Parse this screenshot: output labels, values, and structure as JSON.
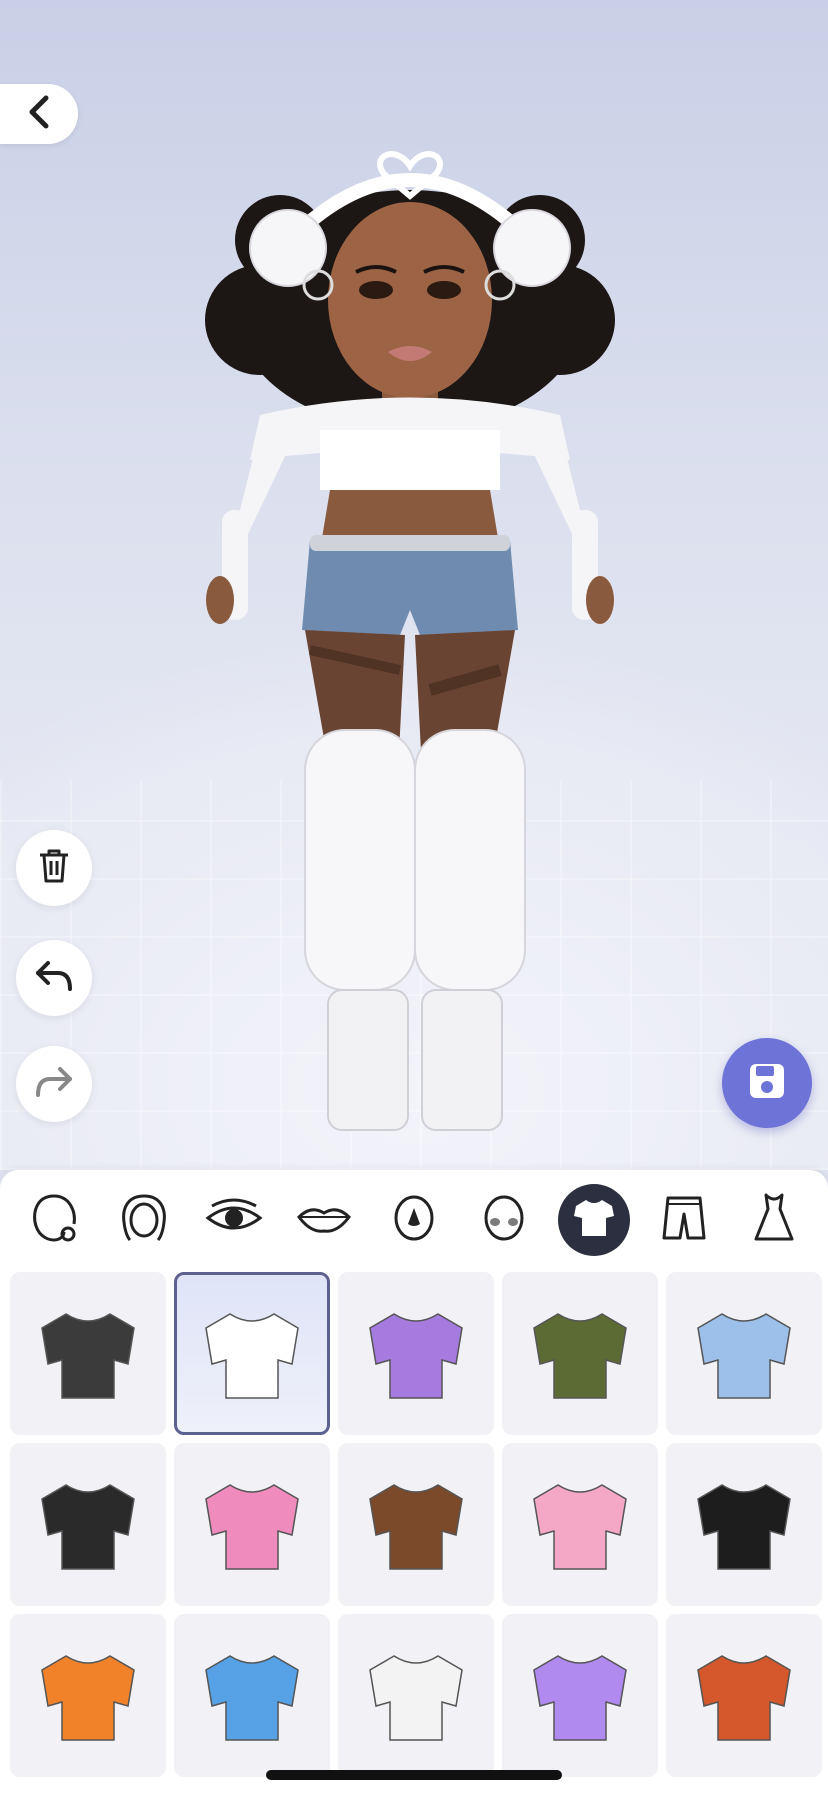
{
  "colors": {
    "accent": "#6e73d8",
    "active_tab": "#2b2f3f",
    "tile_bg": "#f1f1f6",
    "selected_border": "#5d6190"
  },
  "navigation": {
    "back_icon": "chevron-left-icon"
  },
  "tools": [
    {
      "name": "delete",
      "icon": "trash-icon"
    },
    {
      "name": "undo",
      "icon": "undo-icon"
    },
    {
      "name": "redo",
      "icon": "redo-icon"
    }
  ],
  "save_icon": "floppy-disk-icon",
  "category_tabs": [
    {
      "id": "face-shape",
      "icon": "face-shape-icon"
    },
    {
      "id": "hair",
      "icon": "hair-icon"
    },
    {
      "id": "eyes",
      "icon": "eye-icon"
    },
    {
      "id": "lips",
      "icon": "lips-icon"
    },
    {
      "id": "nose",
      "icon": "nose-icon"
    },
    {
      "id": "blush",
      "icon": "blush-icon"
    },
    {
      "id": "tops",
      "icon": "shirt-icon",
      "active": true
    },
    {
      "id": "bottoms",
      "icon": "shorts-icon"
    },
    {
      "id": "dresses",
      "icon": "dress-icon"
    }
  ],
  "items": [
    {
      "id": "striped-crop-top",
      "color": "#3b3b3b",
      "selected": false
    },
    {
      "id": "white-fur-off-shoulder-top",
      "color": "#ffffff",
      "selected": true
    },
    {
      "id": "care-bears-bralette",
      "color": "#a67be0",
      "selected": false
    },
    {
      "id": "olive-turtleneck-crop",
      "color": "#5c6a33",
      "selected": false
    },
    {
      "id": "blue-puff-sleeve-top",
      "color": "#9dc0ea",
      "selected": false
    },
    {
      "id": "black-mesh-halter",
      "color": "#2a2a2a",
      "selected": false
    },
    {
      "id": "pink-checkered-bralette",
      "color": "#f08bbd",
      "selected": false
    },
    {
      "id": "brown-argyle-corset",
      "color": "#7a4a2b",
      "selected": false
    },
    {
      "id": "pink-bow-top",
      "color": "#f5a8c6",
      "selected": false
    },
    {
      "id": "black-red-tie-top",
      "color": "#1d1d1d",
      "selected": false
    },
    {
      "id": "orange-halter-bikini",
      "color": "#f1822a",
      "selected": false
    },
    {
      "id": "blue-cutout-longsleeve",
      "color": "#57a2e6",
      "selected": false
    },
    {
      "id": "white-tie-front-shirt",
      "color": "#f3f3f3",
      "selected": false
    },
    {
      "id": "lavender-zip-crop",
      "color": "#b18af0",
      "selected": false
    },
    {
      "id": "argyle-vest-blouse",
      "color": "#d4582c",
      "selected": false
    }
  ]
}
